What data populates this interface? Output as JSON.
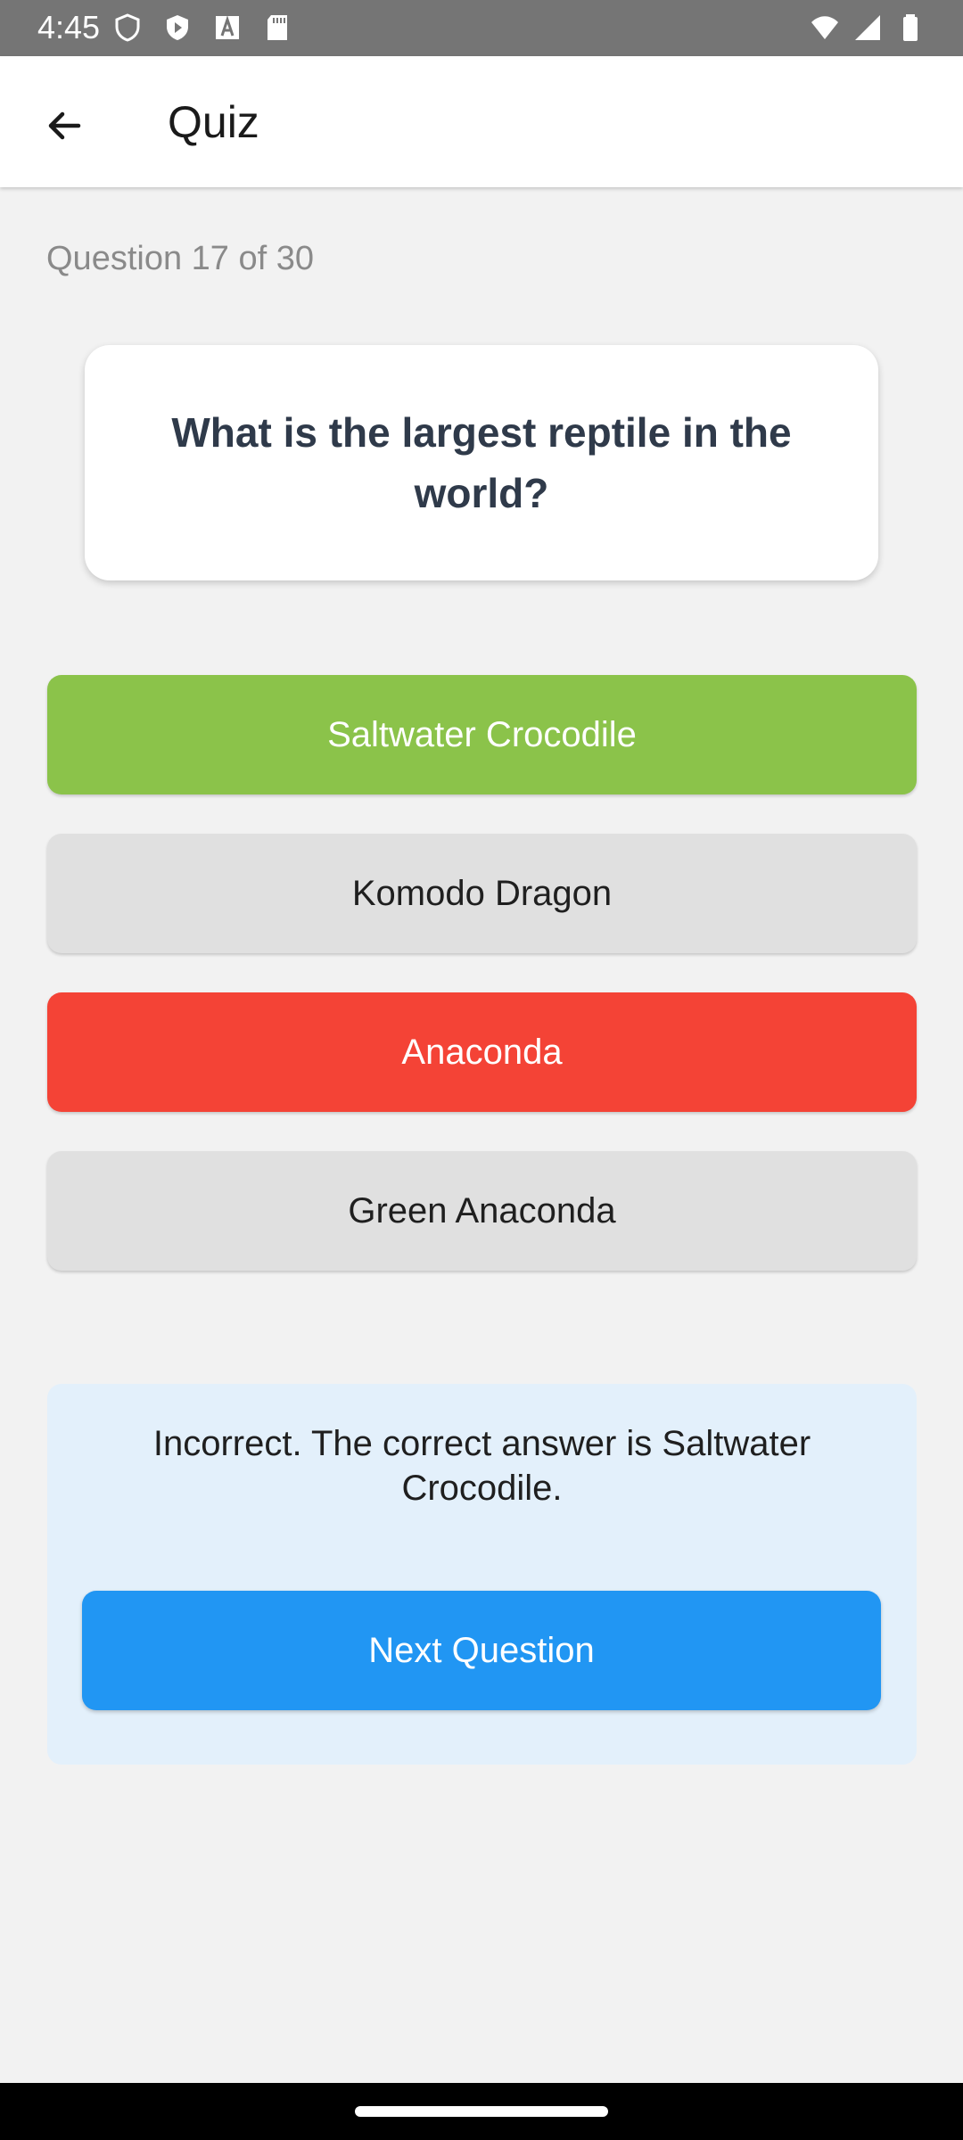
{
  "status_bar": {
    "time": "4:45",
    "icons_left": [
      "shield-icon",
      "play-protect-icon",
      "font-icon",
      "sd-card-icon"
    ],
    "icons_right": [
      "wifi-icon",
      "signal-icon",
      "battery-icon"
    ]
  },
  "app_bar": {
    "title": "Quiz",
    "back_icon": "arrow-left-icon"
  },
  "quiz": {
    "progress": "Question 17 of 30",
    "question": "What is the largest reptile in the world?",
    "answers": [
      {
        "label": "Saltwater Crocodile",
        "state": "correct"
      },
      {
        "label": "Komodo Dragon",
        "state": "neutral"
      },
      {
        "label": "Anaconda",
        "state": "wrong"
      },
      {
        "label": "Green Anaconda",
        "state": "neutral"
      }
    ]
  },
  "feedback": {
    "message": "Incorrect. The correct answer is Saltwater Crocodile.",
    "next_label": "Next Question"
  },
  "colors": {
    "correct": "#8bc34a",
    "wrong": "#f44336",
    "neutral": "#e0e0e0",
    "primary": "#2196f3",
    "feedback_bg": "#e3f0fb"
  }
}
